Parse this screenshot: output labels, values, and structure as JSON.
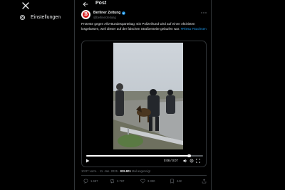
{
  "nav": {
    "logo_icon": "x-logo-icon",
    "settings_label": "Einstellungen",
    "settings_icon": "gear-icon"
  },
  "header": {
    "title": "Post",
    "back_icon": "arrow-left-icon"
  },
  "author": {
    "name": "Berliner Zeitung",
    "handle": "@berlinerzeitung",
    "avatar_letter": "B",
    "verified": true
  },
  "tweet": {
    "text": "Proteste gegen AfD-Bundesparteitag: Ein Polizeihund wird auf einen Aktivisten losgelassen, weil dieser auf der falschen Straßenseite gelaufen war.",
    "hashtags": [
      "#Riesa",
      "#Sachsen"
    ]
  },
  "video": {
    "time": "0:06 / 0:07",
    "progress_fraction": 0.88
  },
  "meta": {
    "timestamp": "10:07 vorm. · 11. Jan. 2025",
    "views_count": "829.801",
    "views_label": "Mal angezeigt"
  },
  "actions": {
    "replies": "1.697",
    "retweets": "2.767",
    "likes": "3.330",
    "bookmarks": "442"
  },
  "colors": {
    "background": "#000000",
    "text": "#e7e9ea",
    "secondary": "#71767b",
    "accent": "#1d9bf0",
    "border": "#2f3336",
    "brand_red": "#d71d1d"
  }
}
